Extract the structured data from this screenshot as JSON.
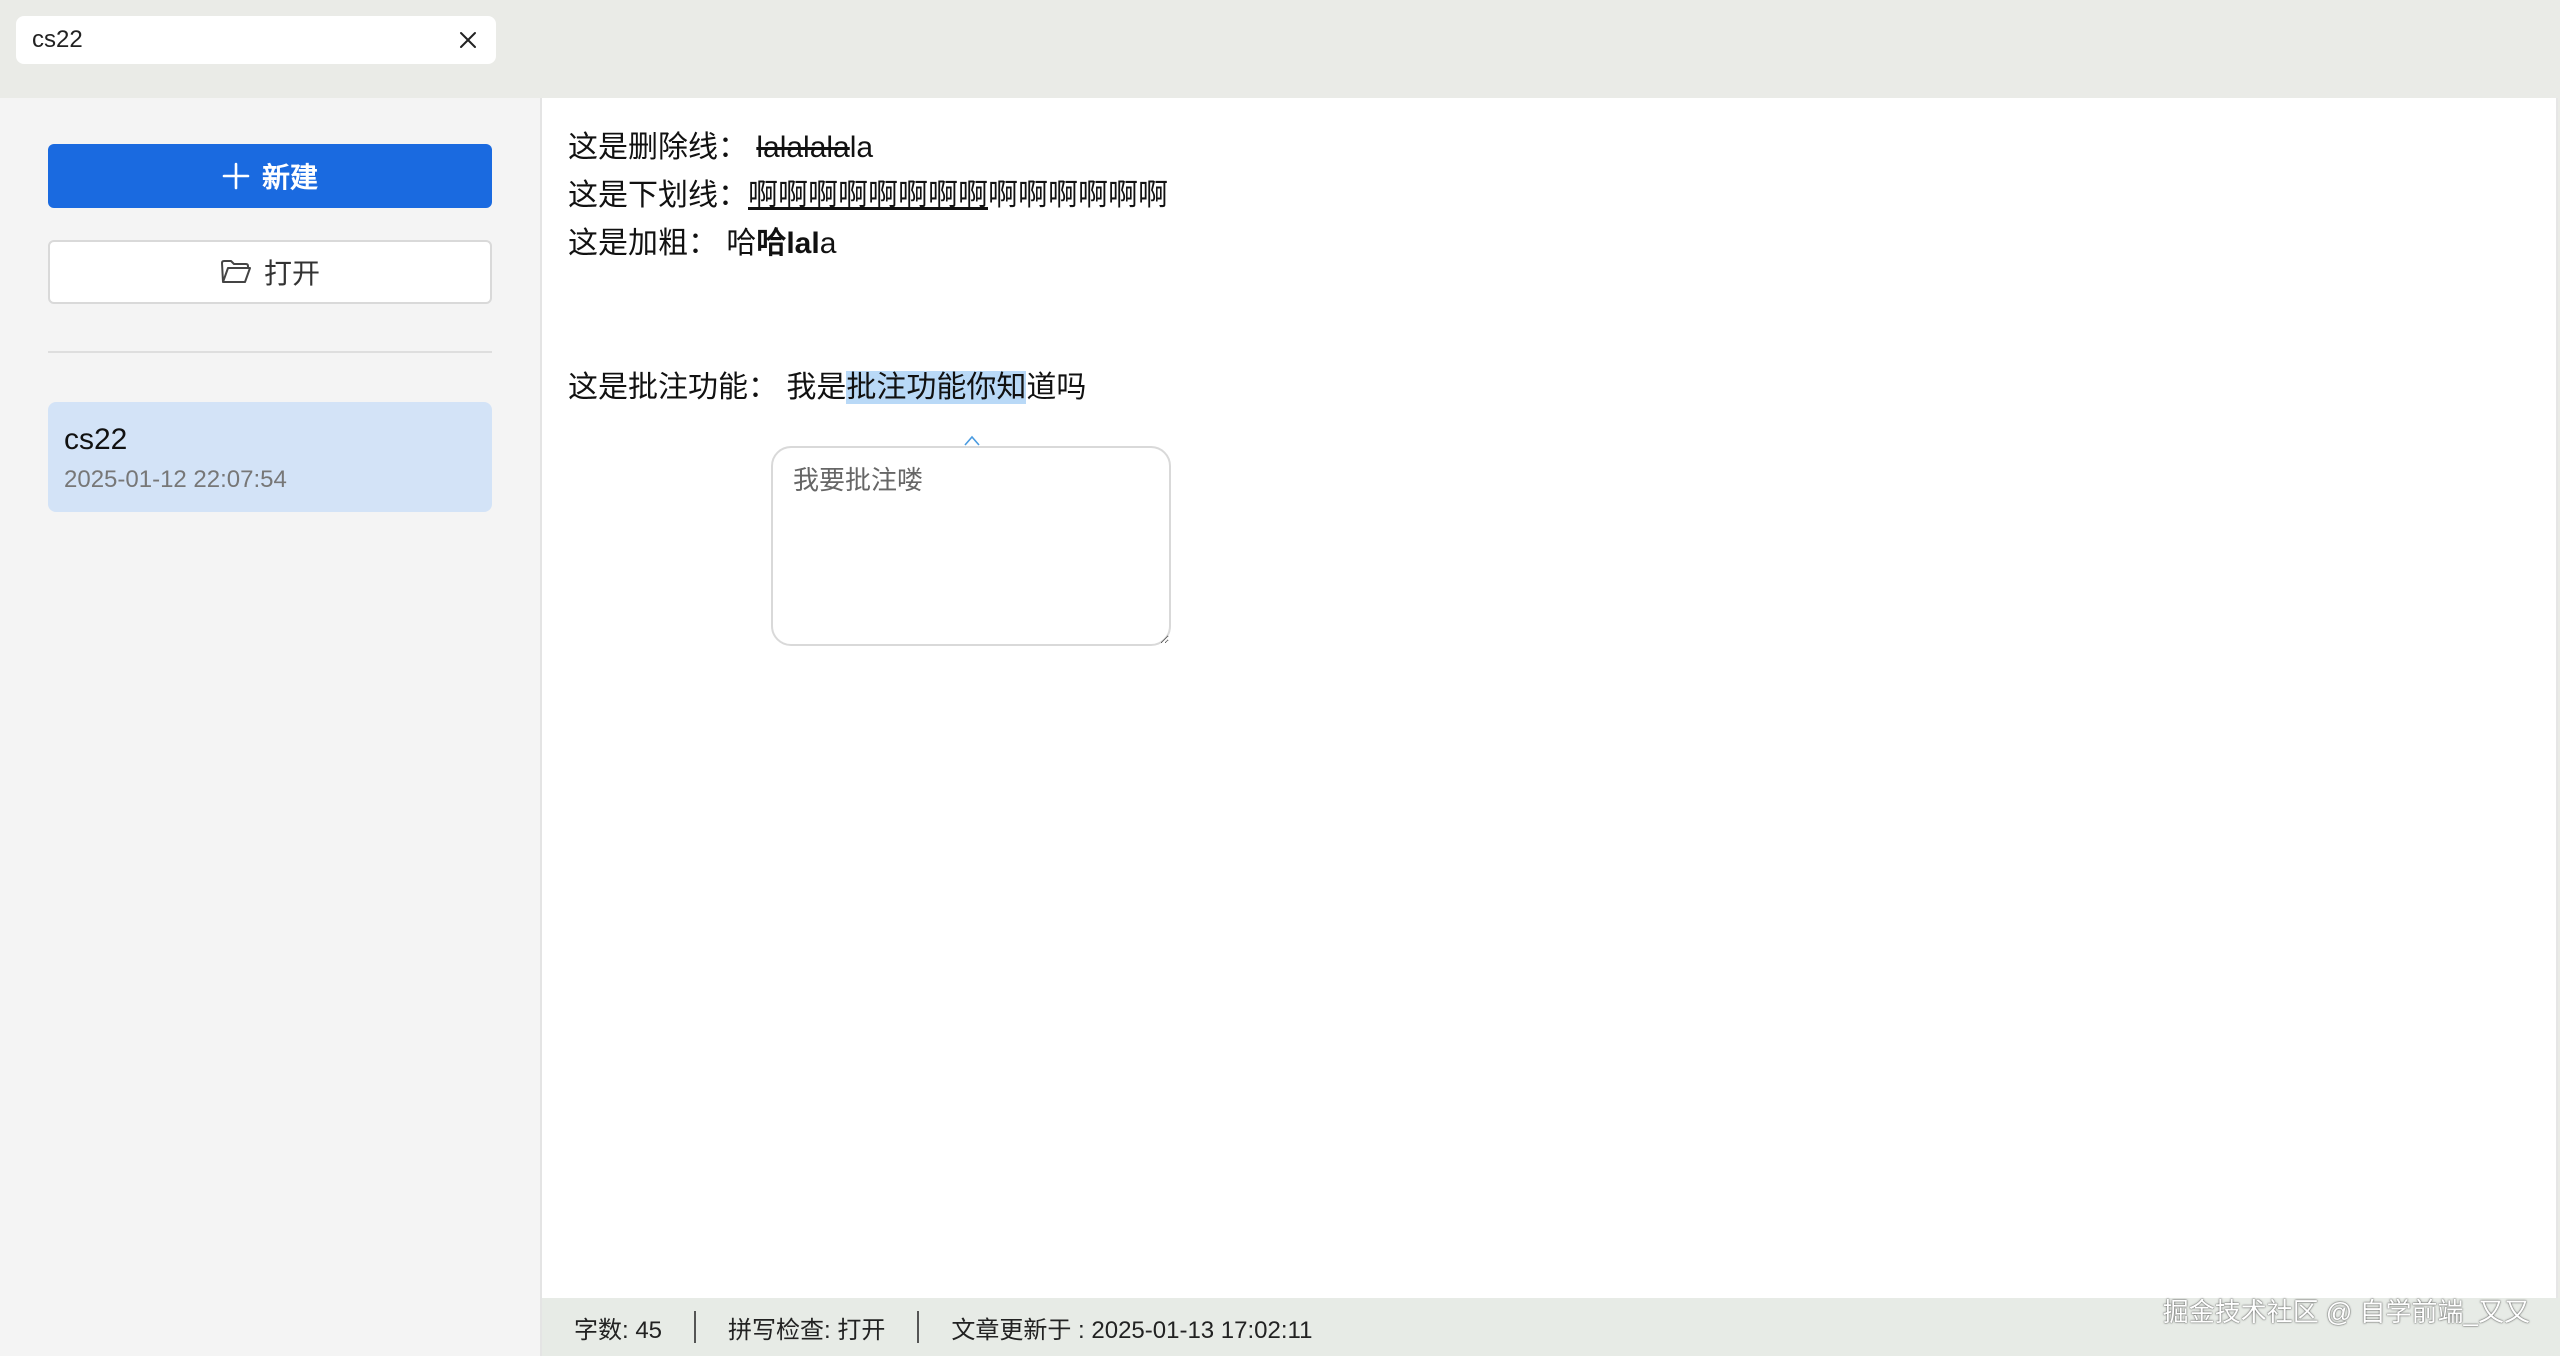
{
  "tab": {
    "title": "cs22",
    "close_icon": "close-icon"
  },
  "sidebar": {
    "new_button_label": "新建",
    "open_button_label": "打开",
    "files": [
      {
        "name": "cs22",
        "date": "2025-01-12 22:07:54"
      }
    ]
  },
  "editor": {
    "line1": {
      "label": "这是删除线：",
      "strike_text": "lalalala",
      "rest": "la"
    },
    "line2": {
      "label": "这是下划线：",
      "under_text": "啊啊啊啊啊啊啊啊",
      "rest": "啊啊啊啊啊啊"
    },
    "line3": {
      "label": "这是加粗：",
      "normal_text": "哈",
      "bold_text": "哈lal",
      "rest": "a"
    },
    "line4": {
      "label": "这是批注功能：",
      "prefix": "我是",
      "highlight": "批注功能你知",
      "rest": "道吗"
    },
    "comment": {
      "value": "",
      "placeholder": "我要批注喽"
    }
  },
  "status_bar": {
    "word_count": "字数: 45",
    "spell_check": "拼写检查: 打开",
    "updated": "文章更新于 : 2025-01-13 17:02:11"
  },
  "watermark": "掘金技术社区 @ 自学前端_又又",
  "colors": {
    "accent": "#1a6ae0",
    "selected_item": "#d3e3f7",
    "highlight": "#b9d9f7"
  }
}
